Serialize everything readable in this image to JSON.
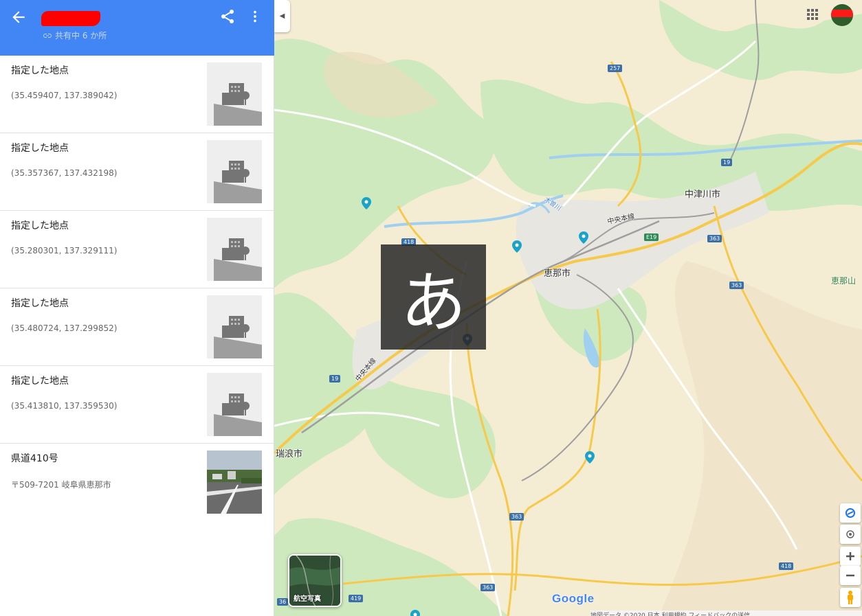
{
  "header": {
    "share_meta": "共有中 6 か所"
  },
  "places": [
    {
      "name": "指定した地点",
      "coords": "(35.459407, 137.389042)"
    },
    {
      "name": "指定した地点",
      "coords": "(35.357367, 137.432198)"
    },
    {
      "name": "指定した地点",
      "coords": "(35.280301, 137.329111)"
    },
    {
      "name": "指定した地点",
      "coords": "(35.480724, 137.299852)"
    },
    {
      "name": "指定した地点",
      "coords": "(35.413810, 137.359530)"
    },
    {
      "name": "県道410号",
      "address": "〒509-7201 岐阜県恵那市"
    }
  ],
  "map": {
    "labels": {
      "nakatsugawa": "中津川市",
      "ena": "恵那市",
      "mizunami": "瑞浪市",
      "enasan": "恵那山",
      "chuo_line_1": "中央本線",
      "chuo_line_2": "中央本線",
      "kiso_river": "木曽川"
    },
    "routes": {
      "r257": "257",
      "r19a": "19",
      "r19b": "19",
      "r418a": "418",
      "r418b": "418",
      "r363a": "363",
      "r363b": "363",
      "r363c": "363",
      "r363d": "363",
      "r419": "419",
      "e19": "E19",
      "r36": "36"
    },
    "ime_char": "あ",
    "aerial_label": "航空写真",
    "google_logo": "Google",
    "footer": "地図データ ©2020 日本 利用規約 フィードバックの送信"
  },
  "colors": {
    "header_bg": "#4285f4",
    "map_land": "#f5ecd4",
    "map_green": "#cde9bd",
    "road_yellow": "#f7c94a",
    "water": "#9fd0f0",
    "pin_teal": "#1aa3c9"
  }
}
